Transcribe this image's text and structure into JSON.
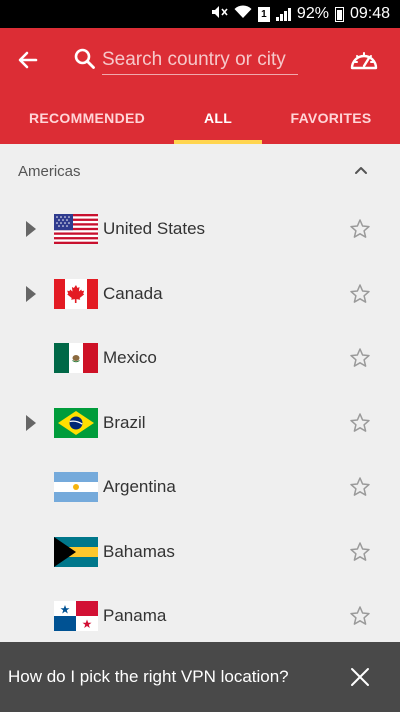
{
  "status_bar": {
    "battery": "92%",
    "time": "09:48",
    "sim": "1"
  },
  "header": {
    "search_placeholder": "Search country or city"
  },
  "tabs": [
    {
      "label": "RECOMMENDED",
      "active": false
    },
    {
      "label": "ALL",
      "active": true
    },
    {
      "label": "FAVORITES",
      "active": false
    }
  ],
  "section": {
    "label": "Americas",
    "expanded": true
  },
  "countries": [
    {
      "name": "United States",
      "expandable": true,
      "favorite": false
    },
    {
      "name": "Canada",
      "expandable": true,
      "favorite": false
    },
    {
      "name": "Mexico",
      "expandable": false,
      "favorite": false
    },
    {
      "name": "Brazil",
      "expandable": true,
      "favorite": false
    },
    {
      "name": "Argentina",
      "expandable": false,
      "favorite": false
    },
    {
      "name": "Bahamas",
      "expandable": false,
      "favorite": false
    },
    {
      "name": "Panama",
      "expandable": false,
      "favorite": false
    }
  ],
  "snackbar": {
    "text": "How do I pick the right VPN location?"
  },
  "colors": {
    "brand_red": "#dc2d35",
    "tab_indicator": "#ffd54f"
  }
}
